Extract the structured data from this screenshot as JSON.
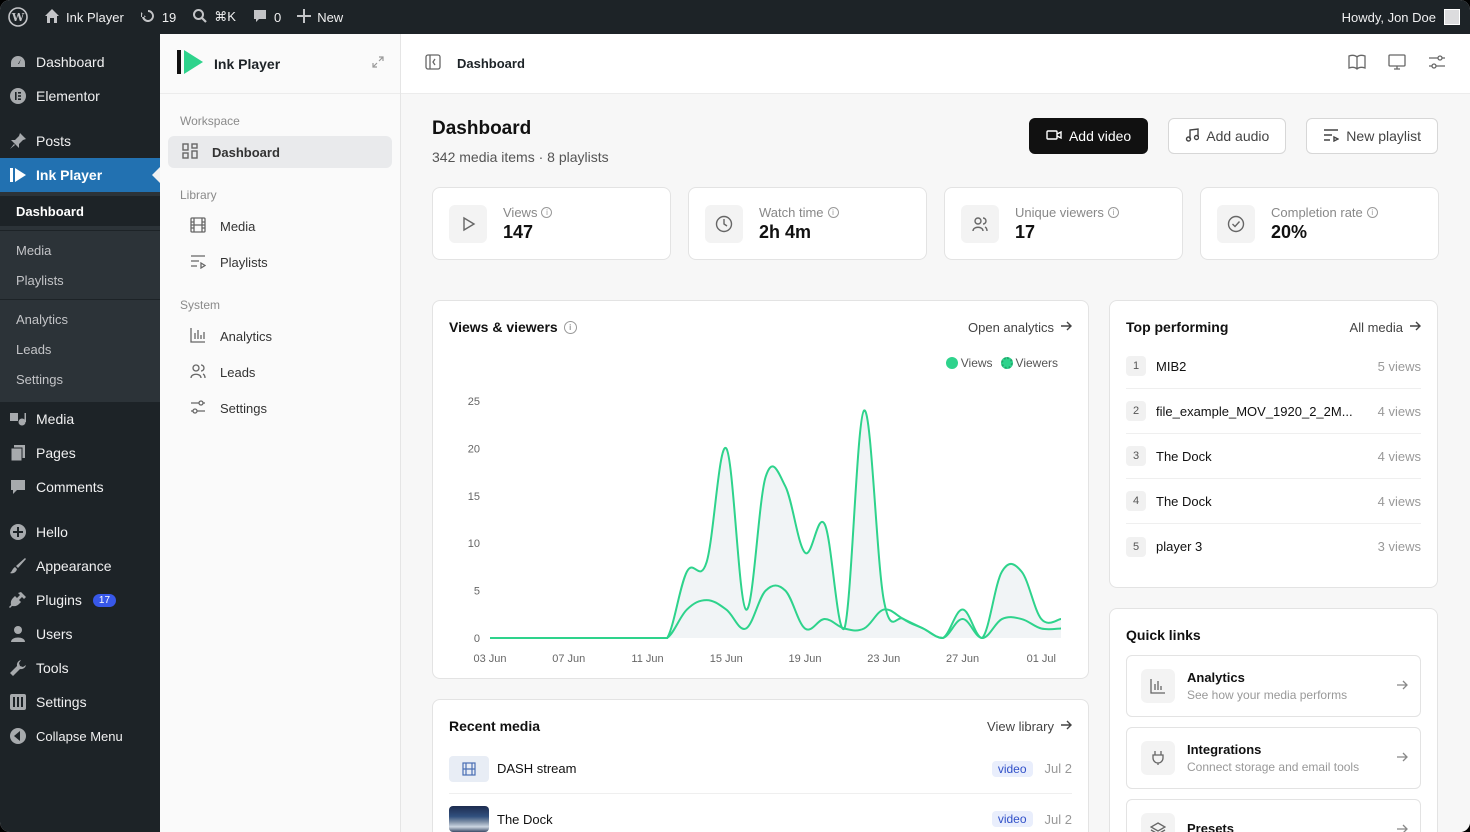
{
  "adminbar": {
    "site_name": "Ink Player",
    "updates": "19",
    "search": "⌘K",
    "comments": "0",
    "new": "New",
    "howdy": "Howdy, Jon Doe"
  },
  "wp_menu": {
    "dashboard": "Dashboard",
    "elementor": "Elementor",
    "posts": "Posts",
    "ink_player": "Ink Player",
    "sub": {
      "dashboard": "Dashboard",
      "media": "Media",
      "playlists": "Playlists",
      "analytics": "Analytics",
      "leads": "Leads",
      "settings": "Settings"
    },
    "media": "Media",
    "pages": "Pages",
    "comments": "Comments",
    "hello": "Hello",
    "appearance": "Appearance",
    "plugins": "Plugins",
    "plugins_badge": "17",
    "users": "Users",
    "tools": "Tools",
    "settings": "Settings",
    "collapse": "Collapse Menu"
  },
  "plugin_nav": {
    "brand": "Ink Player",
    "workspace": "Workspace",
    "dashboard": "Dashboard",
    "library": "Library",
    "media": "Media",
    "playlists": "Playlists",
    "system": "System",
    "analytics": "Analytics",
    "leads": "Leads",
    "settings": "Settings"
  },
  "topbar": {
    "breadcrumb": "Dashboard"
  },
  "header": {
    "title": "Dashboard",
    "subtitle": "342 media items · 8 playlists",
    "add_video": "Add video",
    "add_audio": "Add audio",
    "new_playlist": "New playlist"
  },
  "stats": [
    {
      "label": "Views",
      "value": "147"
    },
    {
      "label": "Watch time",
      "value": "2h 4m"
    },
    {
      "label": "Unique viewers",
      "value": "17"
    },
    {
      "label": "Completion rate",
      "value": "20%"
    }
  ],
  "chart_card": {
    "title": "Views & viewers",
    "link": "Open analytics"
  },
  "chart_data": {
    "type": "line",
    "title": "Views & viewers",
    "x": [
      "03 Jun",
      "04 Jun",
      "05 Jun",
      "06 Jun",
      "07 Jun",
      "08 Jun",
      "09 Jun",
      "10 Jun",
      "11 Jun",
      "12 Jun",
      "13 Jun",
      "14 Jun",
      "15 Jun",
      "16 Jun",
      "17 Jun",
      "18 Jun",
      "19 Jun",
      "20 Jun",
      "21 Jun",
      "22 Jun",
      "23 Jun",
      "24 Jun",
      "25 Jun",
      "26 Jun",
      "27 Jun",
      "28 Jun",
      "29 Jun",
      "30 Jun",
      "01 Jul",
      "02 Jul"
    ],
    "x_ticks": [
      "03 Jun",
      "07 Jun",
      "11 Jun",
      "15 Jun",
      "19 Jun",
      "23 Jun",
      "27 Jun",
      "01 Jul"
    ],
    "ylim": [
      0,
      25
    ],
    "y_ticks": [
      "0",
      "5",
      "10",
      "15",
      "20",
      "25"
    ],
    "legend_position": "top-right",
    "series": [
      {
        "name": "Views",
        "color": "#2ed38c",
        "values": [
          0,
          0,
          0,
          0,
          0,
          0,
          0,
          0,
          0,
          0,
          7,
          8,
          20,
          3,
          17,
          16,
          9,
          12,
          1,
          24,
          4,
          2,
          1,
          0,
          3,
          0,
          7,
          7,
          2,
          2
        ]
      },
      {
        "name": "Viewers",
        "color": "#2ed38c",
        "values": [
          0,
          0,
          0,
          0,
          0,
          0,
          0,
          0,
          0,
          0,
          3,
          4,
          3,
          1,
          5,
          5,
          1,
          2,
          1,
          1,
          3,
          2,
          1,
          0,
          2,
          0,
          2,
          2,
          1,
          1
        ]
      }
    ]
  },
  "top_performing": {
    "title": "Top performing",
    "link": "All media",
    "items": [
      {
        "rank": "1",
        "name": "MIB2",
        "views": "5 views"
      },
      {
        "rank": "2",
        "name": "file_example_MOV_1920_2_2M...",
        "views": "4 views"
      },
      {
        "rank": "3",
        "name": "The Dock",
        "views": "4 views"
      },
      {
        "rank": "4",
        "name": "The Dock",
        "views": "4 views"
      },
      {
        "rank": "5",
        "name": "player 3",
        "views": "3 views"
      }
    ]
  },
  "quick_links": {
    "title": "Quick links",
    "items": [
      {
        "title": "Analytics",
        "desc": "See how your media performs"
      },
      {
        "title": "Integrations",
        "desc": "Connect storage and email tools"
      },
      {
        "title": "Presets",
        "desc": ""
      }
    ]
  },
  "recent_media": {
    "title": "Recent media",
    "link": "View library",
    "items": [
      {
        "name": "DASH stream",
        "tag": "video",
        "date": "Jul 2"
      },
      {
        "name": "The Dock",
        "tag": "video",
        "date": "Jul 2"
      }
    ]
  }
}
